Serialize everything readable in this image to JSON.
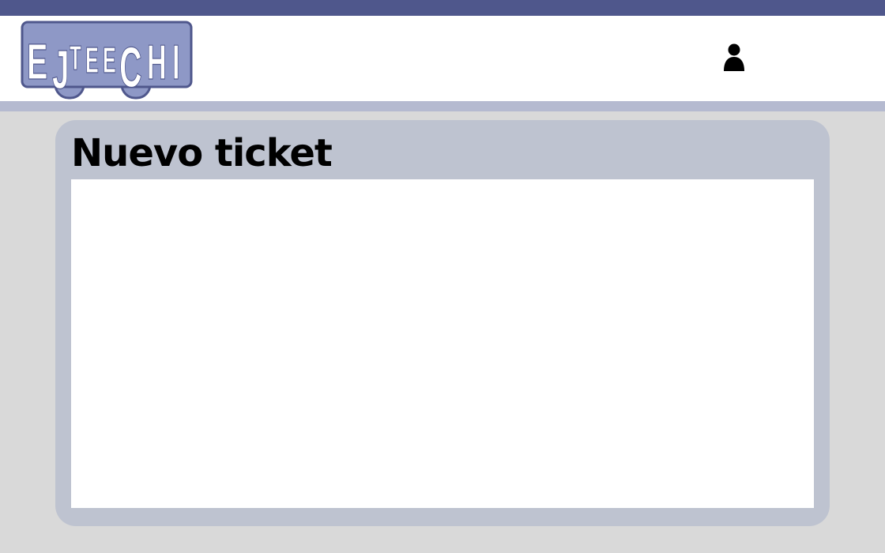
{
  "colors": {
    "topbar": "#4f578c",
    "header_bg": "#ffffff",
    "header_underline": "#b5bad0",
    "page_bg": "#d9d9d9",
    "panel_bg": "#bec3d0",
    "logo_fill": "#8e98c6",
    "logo_stroke": "#4f578c"
  },
  "header": {
    "logo_text": "EJTEECHI",
    "user_icon": "user-icon"
  },
  "panel": {
    "title": "Nuevo ticket"
  }
}
